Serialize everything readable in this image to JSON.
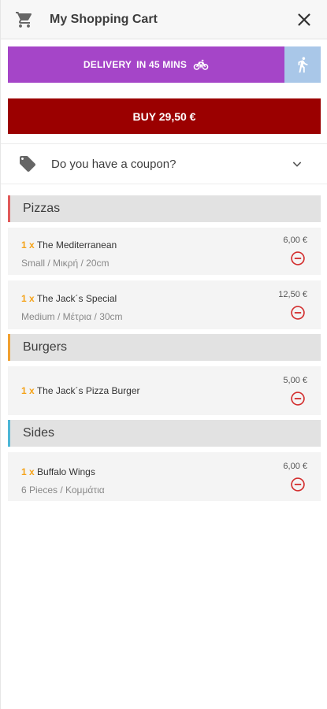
{
  "header": {
    "title": "My Shopping Cart"
  },
  "delivery": {
    "label_part1": "DELIVERY",
    "label_part2": "IN 45 MINS"
  },
  "buy": {
    "label": "BUY 29,50 €"
  },
  "coupon": {
    "label": "Do you have a coupon?"
  },
  "sections": [
    {
      "title": "Pizzas",
      "accent": "#e05a5a",
      "items": [
        {
          "qty": "1 x",
          "name": "The Mediterranean",
          "sub": "Small / Μικρή / 20cm",
          "price": "6,00 €"
        },
        {
          "qty": "1 x",
          "name": "The Jack´s Special",
          "sub": "Medium / Μέτρια / 30cm",
          "price": "12,50 €"
        }
      ]
    },
    {
      "title": "Burgers",
      "accent": "#f0a030",
      "items": [
        {
          "qty": "1 x",
          "name": "The Jack´s Pizza Burger",
          "sub": "",
          "price": "5,00 €"
        }
      ]
    },
    {
      "title": "Sides",
      "accent": "#4db6d6",
      "items": [
        {
          "qty": "1 x",
          "name": "Buffalo Wings",
          "sub": "6 Pieces / Κομμάτια",
          "price": "6,00 €"
        }
      ]
    }
  ],
  "colors": {
    "delivery": "#a545c8",
    "pickup": "#a9c7e8",
    "buy": "#9b0000",
    "qty": "#f5a31a",
    "remove": "#d32f2f"
  },
  "icons": {
    "header": [
      "shopping-cart-icon",
      "close-icon"
    ],
    "delivery": "bicycle-icon",
    "pickup": "walking-person-icon",
    "coupon": [
      "tag-icon",
      "chevron-down-icon"
    ],
    "item": "remove-circle-icon"
  }
}
